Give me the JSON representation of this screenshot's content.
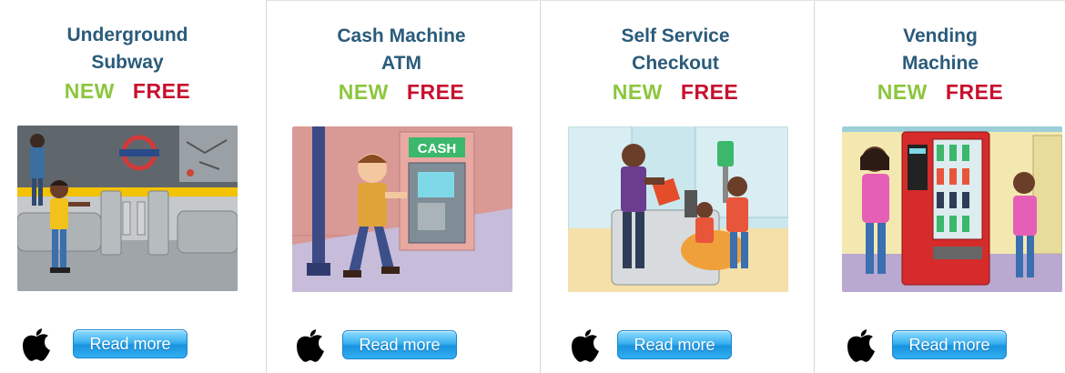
{
  "cards": [
    {
      "title_line1": "Underground",
      "title_line2": "Subway",
      "new_label": "NEW",
      "free_label": "FREE",
      "illustration": "subway-scene",
      "button_label": "Read more",
      "platform_icon": "apple-icon"
    },
    {
      "title_line1": "Cash Machine",
      "title_line2": "ATM",
      "new_label": "NEW",
      "free_label": "FREE",
      "illustration": "atm-scene",
      "illustration_sign": "CASH",
      "button_label": "Read more",
      "platform_icon": "apple-icon"
    },
    {
      "title_line1": "Self Service",
      "title_line2": "Checkout",
      "new_label": "NEW",
      "free_label": "FREE",
      "illustration": "checkout-scene",
      "button_label": "Read more",
      "platform_icon": "apple-icon"
    },
    {
      "title_line1": "Vending",
      "title_line2": "Machine",
      "new_label": "NEW",
      "free_label": "FREE",
      "illustration": "vending-scene",
      "button_label": "Read more",
      "platform_icon": "apple-icon"
    }
  ],
  "colors": {
    "title": "#2a5b7a",
    "new": "#8cc63f",
    "free": "#c8102e",
    "button": "#33aef0",
    "divider": "#d6d6d6"
  }
}
